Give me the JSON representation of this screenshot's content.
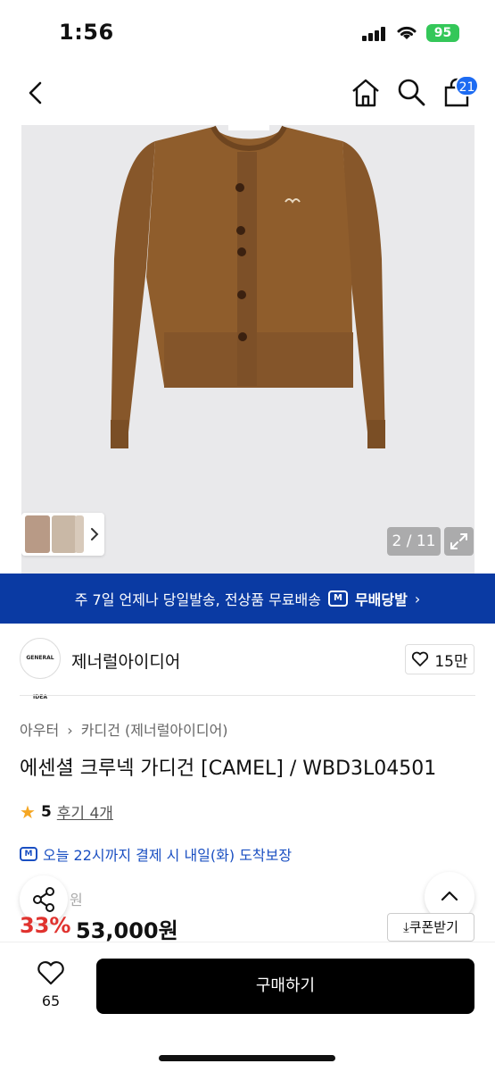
{
  "status_bar": {
    "time": "1:56",
    "battery": "95"
  },
  "nav": {
    "cart_count": "21"
  },
  "gallery": {
    "counter": "2 / 11",
    "product_logo_text": "GENERAL IDEA"
  },
  "banner": {
    "text": "주 7일 언제나 당일발송, 전상품 무료배송",
    "badge": "M",
    "brand": "무배당발",
    "chevron": "›"
  },
  "brand": {
    "logo_text": "GENERAL IDEA",
    "name": "제너럴아이디어",
    "likes": "15만"
  },
  "breadcrumb": {
    "category": "아우터",
    "separator": "›",
    "subcategory": "카디건 (제너럴아이디어)"
  },
  "product": {
    "title": "에센셜 크루넥 가디건 [CAMEL] / WBD3L04501",
    "rating": "5",
    "reviews": "후기 4개",
    "delivery": "오늘 22시까지 결제 시 내일(화) 도착보장",
    "delivery_badge": "M",
    "original_price_suffix": "원",
    "discount": "33%",
    "price": "53,000원"
  },
  "actions": {
    "coupon": "⤓쿠폰받기",
    "heart_count": "65",
    "buy": "구매하기"
  },
  "colors": {
    "accent_blue": "#0a3aa3",
    "discount_red": "#e0322e",
    "product_brown": "#8a5a2b"
  }
}
